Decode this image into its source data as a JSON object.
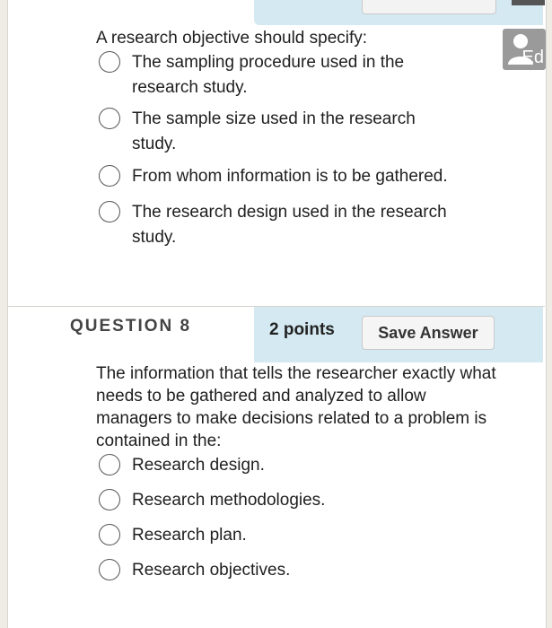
{
  "question7": {
    "prompt": "A research objective should specify:",
    "options": [
      "The sampling procedure used in the research study.",
      "The sample size used in the research study.",
      "From whom information is to be gathered.",
      "The research design used in the research study."
    ]
  },
  "question8": {
    "label": "QUESTION 8",
    "points": "2 points",
    "save_label": "Save Answer",
    "prompt": "The information that tells the researcher exactly what needs to be gathered and analyzed to allow managers to make decisions related to a problem is contained in the:",
    "options": [
      "Research design.",
      "Research methodologies.",
      "Research plan.",
      "Research objectives."
    ]
  },
  "avatar": {
    "icon": "user-icon",
    "letters": "Ed"
  }
}
